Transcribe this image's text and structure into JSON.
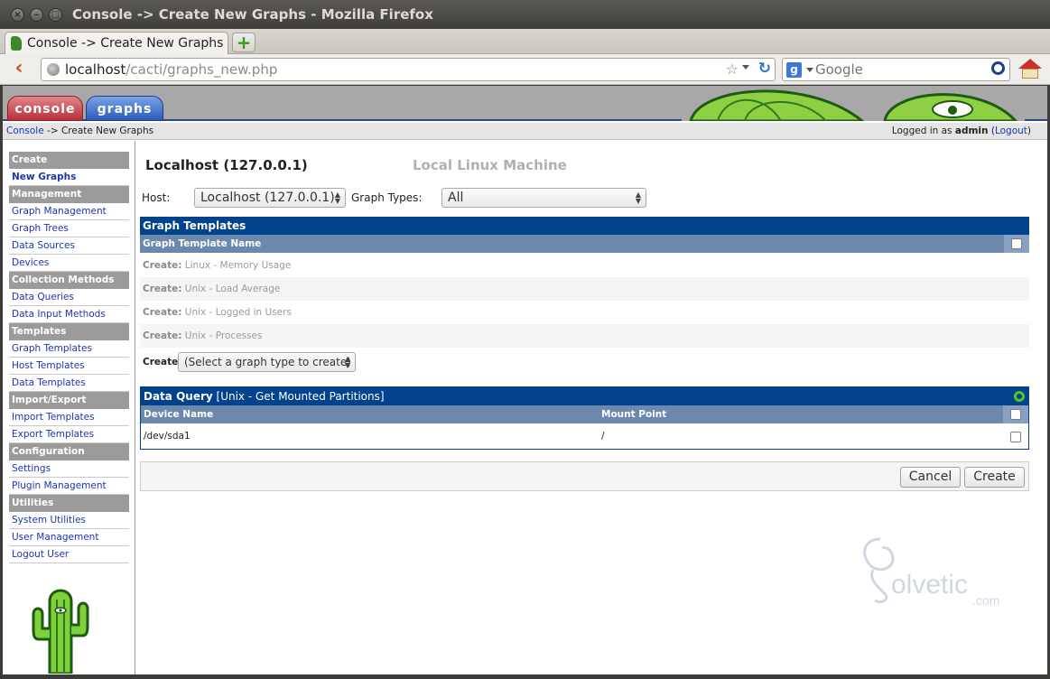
{
  "window": {
    "title": "Console -> Create New Graphs - Mozilla Firefox"
  },
  "browser": {
    "tab_title": "Console -> Create New Graphs",
    "url_host": "localhost",
    "url_path": "/cacti/graphs_new.php",
    "search_placeholder": "Google"
  },
  "cacti": {
    "tabs": [
      "console",
      "graphs"
    ],
    "breadcrumb": {
      "root": "Console",
      "separator": " -> ",
      "current": "Create New Graphs"
    },
    "login": {
      "prefix": "Logged in as ",
      "user": "admin",
      "logout_open": " (",
      "logout_label": "Logout",
      "logout_close": ")"
    }
  },
  "sidebar": {
    "sections": [
      {
        "header": "Create",
        "items": [
          {
            "label": "New Graphs",
            "selected": true
          }
        ]
      },
      {
        "header": "Management",
        "items": [
          {
            "label": "Graph Management"
          },
          {
            "label": "Graph Trees"
          },
          {
            "label": "Data Sources"
          },
          {
            "label": "Devices"
          }
        ]
      },
      {
        "header": "Collection Methods",
        "items": [
          {
            "label": "Data Queries"
          },
          {
            "label": "Data Input Methods"
          }
        ]
      },
      {
        "header": "Templates",
        "items": [
          {
            "label": "Graph Templates"
          },
          {
            "label": "Host Templates"
          },
          {
            "label": "Data Templates"
          }
        ]
      },
      {
        "header": "Import/Export",
        "items": [
          {
            "label": "Import Templates"
          },
          {
            "label": "Export Templates"
          }
        ]
      },
      {
        "header": "Configuration",
        "items": [
          {
            "label": "Settings"
          },
          {
            "label": "Plugin Management"
          }
        ]
      },
      {
        "header": "Utilities",
        "items": [
          {
            "label": "System Utilities"
          },
          {
            "label": "User Management"
          },
          {
            "label": "Logout User"
          }
        ]
      }
    ]
  },
  "main": {
    "host_title": "Localhost (127.0.0.1)",
    "host_description": "Local Linux Machine",
    "host_label": "Host:",
    "host_value": "Localhost (127.0.0.1)",
    "graph_types_label": "Graph Types:",
    "graph_types_value": "All",
    "graph_templates": {
      "title": "Graph Templates",
      "column": "Graph Template Name",
      "create_prefix": "Create:",
      "rows": [
        "Linux - Memory Usage",
        "Unix - Load Average",
        "Unix - Logged in Users",
        "Unix - Processes"
      ]
    },
    "create_label": "Create:",
    "create_select_value": "(Select a graph type to create)",
    "data_query": {
      "title": "Data Query",
      "name": "[Unix - Get Mounted Partitions]",
      "columns": [
        "Device Name",
        "Mount Point"
      ],
      "rows": [
        {
          "device": "/dev/sda1",
          "mount": "/"
        }
      ]
    },
    "buttons": {
      "cancel": "Cancel",
      "create": "Create"
    }
  },
  "watermark": {
    "text": "olvetic",
    "suffix": ".com"
  },
  "colors": {
    "header_blue": "#00438c",
    "column_blue": "#6d88ad",
    "sidebar_header": "#9b9b9b",
    "link": "#1c35b3"
  }
}
